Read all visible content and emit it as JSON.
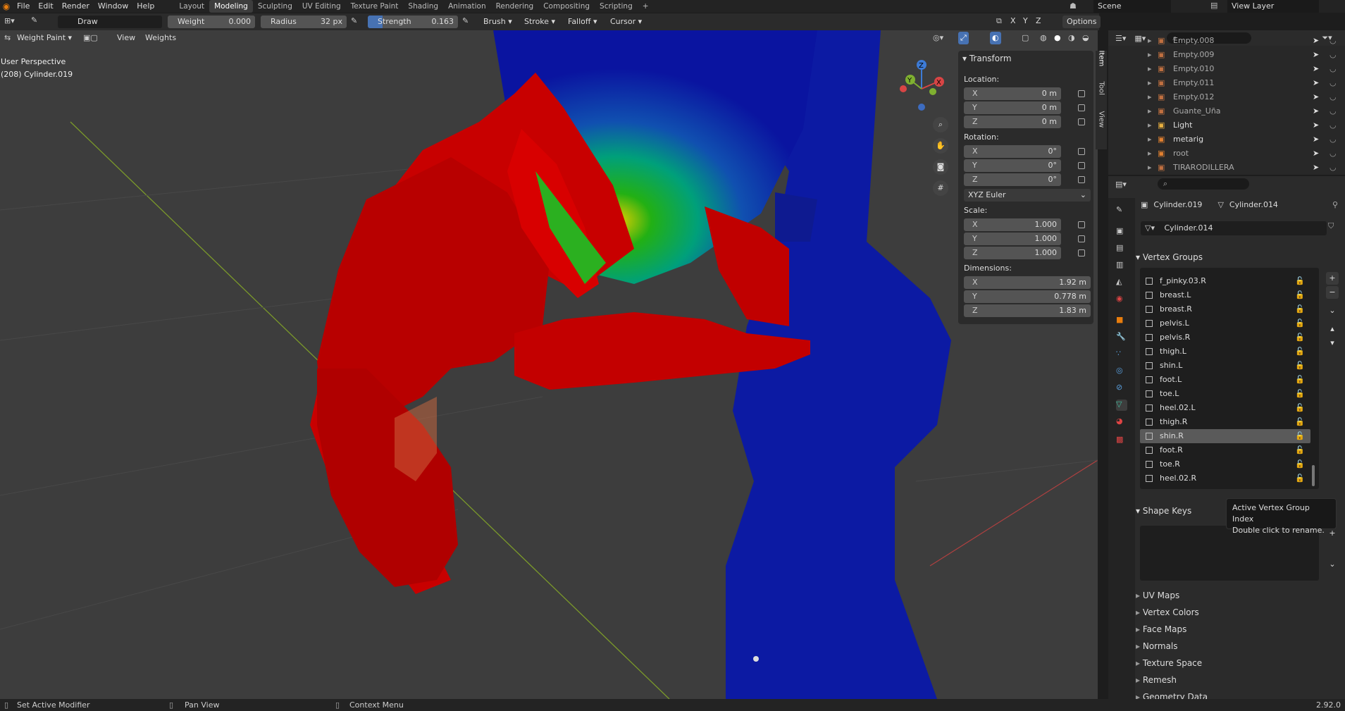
{
  "app": {
    "version": "2.92.0"
  },
  "menu": [
    "File",
    "Edit",
    "Render",
    "Window",
    "Help"
  ],
  "workspaces": [
    {
      "label": "Layout",
      "active": false
    },
    {
      "label": "Modeling",
      "active": true
    },
    {
      "label": "Sculpting",
      "active": false
    },
    {
      "label": "UV Editing",
      "active": false
    },
    {
      "label": "Texture Paint",
      "active": false
    },
    {
      "label": "Shading",
      "active": false
    },
    {
      "label": "Animation",
      "active": false
    },
    {
      "label": "Rendering",
      "active": false
    },
    {
      "label": "Compositing",
      "active": false
    },
    {
      "label": "Scripting",
      "active": false
    }
  ],
  "scene": "Scene",
  "view_layer": "View Layer",
  "tool_header": {
    "brush": "Draw",
    "weight_label": "Weight",
    "weight_value": "0.000",
    "radius_label": "Radius",
    "radius_value": "32 px",
    "strength_label": "Strength",
    "strength_value": "0.163",
    "brush_menu": "Brush",
    "stroke_menu": "Stroke",
    "falloff_menu": "Falloff",
    "cursor_menu": "Cursor",
    "xyz": [
      "X",
      "Y",
      "Z"
    ],
    "options": "Options"
  },
  "viewport": {
    "mode": "Weight Paint",
    "view_menu": "View",
    "weights_menu": "Weights",
    "perspective": "User Perspective",
    "object_info": "(208) Cylinder.019"
  },
  "npanel": {
    "title": "Transform",
    "location_label": "Location:",
    "location": [
      {
        "axis": "X",
        "value": "0 m"
      },
      {
        "axis": "Y",
        "value": "0 m"
      },
      {
        "axis": "Z",
        "value": "0 m"
      }
    ],
    "rotation_label": "Rotation:",
    "rotation": [
      {
        "axis": "X",
        "value": "0°"
      },
      {
        "axis": "Y",
        "value": "0°"
      },
      {
        "axis": "Z",
        "value": "0°"
      }
    ],
    "rotation_mode": "XYZ Euler",
    "scale_label": "Scale:",
    "scale": [
      {
        "axis": "X",
        "value": "1.000"
      },
      {
        "axis": "Y",
        "value": "1.000"
      },
      {
        "axis": "Z",
        "value": "1.000"
      }
    ],
    "dimensions_label": "Dimensions:",
    "dimensions": [
      {
        "axis": "X",
        "value": "1.92 m"
      },
      {
        "axis": "Y",
        "value": "0.778 m"
      },
      {
        "axis": "Z",
        "value": "1.83 m"
      }
    ],
    "tabs": [
      "Item",
      "Tool",
      "View"
    ]
  },
  "outliner": {
    "items": [
      {
        "name": "Empty.008"
      },
      {
        "name": "Empty.009"
      },
      {
        "name": "Empty.010"
      },
      {
        "name": "Empty.011"
      },
      {
        "name": "Empty.012"
      },
      {
        "name": "Guante_Uña"
      },
      {
        "name": "Light"
      },
      {
        "name": "metarig"
      },
      {
        "name": "root"
      },
      {
        "name": "TIRARODILLERA"
      }
    ]
  },
  "properties": {
    "object_name": "Cylinder.019",
    "mesh_name": "Cylinder.014",
    "mesh_field": "Cylinder.014",
    "vertex_groups_title": "Vertex Groups",
    "vertex_groups": [
      "f_pinky.03.R",
      "breast.L",
      "breast.R",
      "pelvis.L",
      "pelvis.R",
      "thigh.L",
      "shin.L",
      "foot.L",
      "toe.L",
      "heel.02.L",
      "thigh.R",
      "shin.R",
      "foot.R",
      "toe.R",
      "heel.02.R"
    ],
    "selected_group": "shin.R",
    "shape_keys_title": "Shape Keys",
    "collapsed_sections": [
      "UV Maps",
      "Vertex Colors",
      "Face Maps",
      "Normals",
      "Texture Space",
      "Remesh",
      "Geometry Data"
    ]
  },
  "tooltip": {
    "line1": "Active Vertex Group Index",
    "line2": "Double click to rename."
  },
  "statusbar": {
    "left": "Set Active Modifier",
    "middle": "Pan View",
    "right": "Context Menu"
  }
}
